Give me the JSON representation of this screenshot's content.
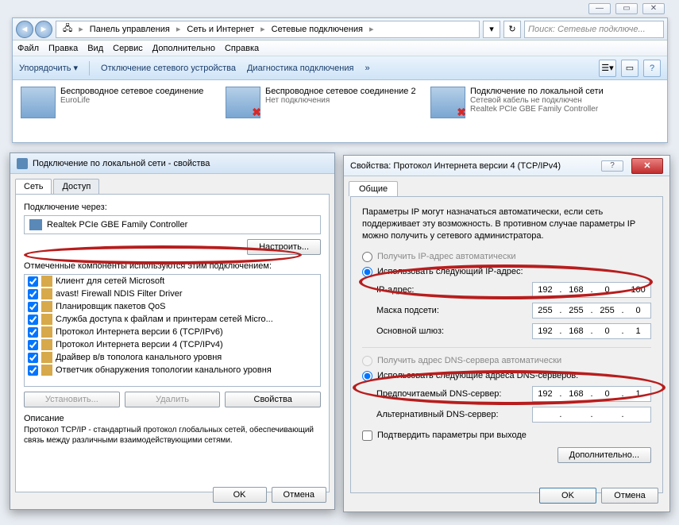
{
  "window_controls": {
    "min": "—",
    "max": "▭",
    "close": "✕"
  },
  "breadcrumb": {
    "seg1": "Панель управления",
    "seg2": "Сеть и Интернет",
    "seg3": "Сетевые подключения"
  },
  "search": {
    "placeholder": "Поиск: Сетевые подключе..."
  },
  "menubar": {
    "file": "Файл",
    "edit": "Правка",
    "view": "Вид",
    "service": "Сервис",
    "extra": "Дополнительно",
    "help": "Справка"
  },
  "cmdbar": {
    "organize": "Упорядочить ▾",
    "disable": "Отключение сетевого устройства",
    "diag": "Диагностика подключения",
    "more": "»"
  },
  "connections": [
    {
      "title": "Беспроводное сетевое соединение",
      "sub": "EuroLife",
      "brand": "",
      "x": false
    },
    {
      "title": "Беспроводное сетевое соединение 2",
      "sub": "Нет подключения",
      "brand": "",
      "x": true
    },
    {
      "title": "Подключение по локальной сети",
      "sub": "Сетевой кабель не подключен",
      "brand": "Realtek PCIe GBE Family Controller",
      "x": true
    }
  ],
  "dlg1": {
    "title": "Подключение по локальной сети - свойства",
    "tabs": {
      "net": "Сеть",
      "access": "Доступ"
    },
    "connect_via": "Подключение через:",
    "adapter": "Realtek PCIe GBE Family Controller",
    "configure": "Настроить...",
    "components_label": "Отмеченные компоненты используются этим подключением:",
    "items": [
      "Клиент для сетей Microsoft",
      "avast! Firewall NDIS Filter Driver",
      "Планировщик пакетов QoS",
      "Служба доступа к файлам и принтерам сетей Micro...",
      "Протокол Интернета версии 6 (TCP/IPv6)",
      "Протокол Интернета версии 4 (TCP/IPv4)",
      "Драйвер в/в тополога канального уровня",
      "Ответчик обнаружения топологии канального уровня"
    ],
    "install": "Установить...",
    "remove": "Удалить",
    "props": "Свойства",
    "desc_label": "Описание",
    "desc": "Протокол TCP/IP - стандартный протокол глобальных сетей, обеспечивающий связь между различными взаимодействующими сетями.",
    "ok": "OK",
    "cancel": "Отмена"
  },
  "dlg2": {
    "title": "Свойства: Протокол Интернета версии 4 (TCP/IPv4)",
    "tab": "Общие",
    "info": "Параметры IP могут назначаться автоматически, если сеть поддерживает эту возможность. В противном случае параметры IP можно получить у сетевого администратора.",
    "auto_ip": "Получить IP-адрес автоматически",
    "manual_ip": "Использовать следующий IP-адрес:",
    "ip_label": "IP-адрес:",
    "mask_label": "Маска подсети:",
    "gw_label": "Основной шлюз:",
    "ip": [
      "192",
      "168",
      "0",
      "100"
    ],
    "mask": [
      "255",
      "255",
      "255",
      "0"
    ],
    "gw": [
      "192",
      "168",
      "0",
      "1"
    ],
    "auto_dns": "Получить адрес DNS-сервера автоматически",
    "manual_dns": "Использовать следующие адреса DNS-серверов:",
    "dns1_label": "Предпочитаемый DNS-сервер:",
    "dns2_label": "Альтернативный DNS-сервер:",
    "dns1": [
      "192",
      "168",
      "0",
      "1"
    ],
    "confirm": "Подтвердить параметры при выходе",
    "advanced": "Дополнительно...",
    "ok": "OK",
    "cancel": "Отмена"
  }
}
